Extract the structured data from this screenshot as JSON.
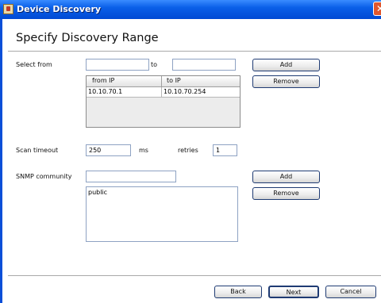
{
  "window": {
    "title": "Device Discovery",
    "close_glyph": "✕"
  },
  "page": {
    "heading": "Specify Discovery Range"
  },
  "range": {
    "select_from_label": "Select from",
    "from_value": "",
    "to_label": "to",
    "to_value": "",
    "add_label": "Add",
    "remove_label": "Remove",
    "table": {
      "columns": [
        "from IP",
        "to IP"
      ],
      "rows": [
        [
          "10.10.70.1",
          "10.10.70.254"
        ]
      ]
    }
  },
  "scan": {
    "timeout_label": "Scan timeout",
    "timeout_value": "250",
    "ms_label": "ms",
    "retries_label": "retries",
    "retries_value": "1"
  },
  "snmp": {
    "label": "SNMP community",
    "input_value": "",
    "add_label": "Add",
    "remove_label": "Remove",
    "communities": [
      "public"
    ]
  },
  "footer": {
    "back_label": "Back",
    "next_label": "Next",
    "cancel_label": "Cancel"
  }
}
